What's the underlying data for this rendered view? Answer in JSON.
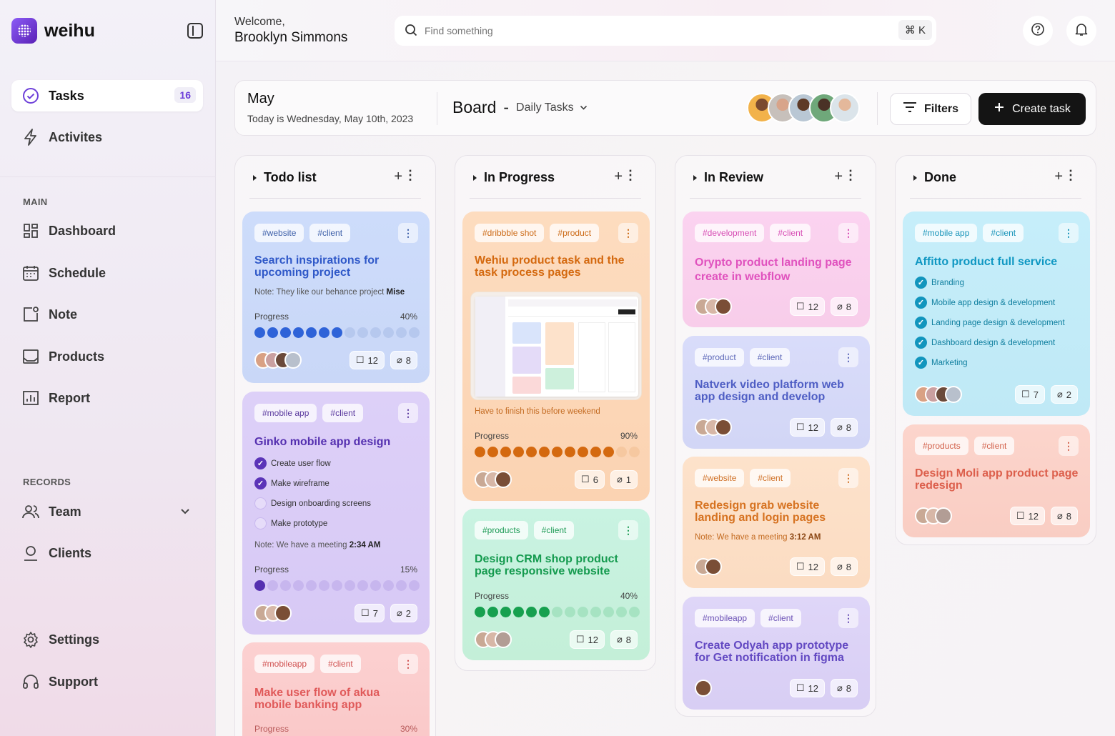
{
  "app": {
    "name": "weihu"
  },
  "sidebar": {
    "nav": [
      {
        "label": "Tasks",
        "badge": "16",
        "icon": "check-circle-icon"
      },
      {
        "label": "Activites",
        "icon": "lightning-icon"
      }
    ],
    "main_label": "MAIN",
    "main": [
      {
        "label": "Dashboard",
        "icon": "grid-icon"
      },
      {
        "label": "Schedule",
        "icon": "calendar-icon"
      },
      {
        "label": "Note",
        "icon": "note-icon"
      },
      {
        "label": "Products",
        "icon": "inbox-icon"
      },
      {
        "label": "Report",
        "icon": "chart-icon"
      }
    ],
    "records_label": "RECORDS",
    "records": [
      {
        "label": "Team",
        "icon": "users-icon"
      },
      {
        "label": "Clients",
        "icon": "user-icon"
      }
    ],
    "bottom": [
      {
        "label": "Settings",
        "icon": "gear-icon"
      },
      {
        "label": "Support",
        "icon": "headset-icon"
      }
    ]
  },
  "topbar": {
    "welcome": "Welcome,",
    "user": "Brooklyn Simmons",
    "search_placeholder": "Find something",
    "shortcut": "⌘ K"
  },
  "header": {
    "month": "May",
    "today": "Today is Wednesday, May 10th, 2023",
    "board": "Board",
    "dash": "-",
    "view": "Daily Tasks",
    "filters": "Filters",
    "create": "Create task"
  },
  "colors": {
    "accent": "#141414",
    "brand": "#6d3fd9"
  },
  "columns": [
    {
      "title": "Todo list",
      "cards": [
        {
          "tags": [
            "#website",
            "#client"
          ],
          "title": "Search inspirations for upcoming project",
          "note_prefix": "Note:  They like our behance project",
          "note_bold": "Mise",
          "progress_label": "Progress",
          "progress": "40%",
          "comments": "12",
          "attachments": "8"
        },
        {
          "tags": [
            "#mobile app",
            "#client"
          ],
          "title": "Ginko mobile app design",
          "checklist": [
            {
              "text": "Create user flow",
              "done": true
            },
            {
              "text": "Make wireframe",
              "done": true
            },
            {
              "text": "Design onboarding screens",
              "done": false
            },
            {
              "text": "Make prototype",
              "done": false
            }
          ],
          "note_prefix": "Note:  We have a meeting",
          "note_bold": "2:34 AM",
          "progress_label": "Progress",
          "progress": "15%",
          "comments": "7",
          "attachments": "2"
        },
        {
          "tags": [
            "#mobileapp",
            "#client"
          ],
          "title": "Make user flow of akua mobile banking app",
          "progress_label": "Progress",
          "progress": "30%"
        }
      ]
    },
    {
      "title": "In Progress",
      "cards": [
        {
          "tags": [
            "#dribbble shot",
            "#product"
          ],
          "title": "Wehiu product task and the task process pages",
          "note": "Have to finish this before weekend",
          "progress_label": "Progress",
          "progress": "90%",
          "comments": "6",
          "attachments": "1"
        },
        {
          "tags": [
            "#products",
            "#client"
          ],
          "title": "Design CRM shop product page responsive website",
          "progress_label": "Progress",
          "progress": "40%",
          "comments": "12",
          "attachments": "8"
        }
      ]
    },
    {
      "title": "In Review",
      "cards": [
        {
          "tags": [
            "#development",
            "#client"
          ],
          "title": "Orypto product landing  page create in webflow",
          "comments": "12",
          "attachments": "8"
        },
        {
          "tags": [
            "#product",
            "#client"
          ],
          "title": "Natverk video platform web app design and develop",
          "comments": "12",
          "attachments": "8"
        },
        {
          "tags": [
            "#website",
            "#client"
          ],
          "title": "Redesign grab website landing and login pages",
          "note_prefix": "Note:  We have a meeting",
          "note_bold": "3:12 AM",
          "comments": "12",
          "attachments": "8"
        },
        {
          "tags": [
            "#mobileapp",
            "#client"
          ],
          "title": "Create Odyah app prototype for Get notification in figma",
          "comments": "12",
          "attachments": "8"
        }
      ]
    },
    {
      "title": "Done",
      "cards": [
        {
          "tags": [
            "#mobile app",
            "#client"
          ],
          "title": "Affitto product full service",
          "checklist": [
            {
              "text": "Branding",
              "done": true
            },
            {
              "text": "Mobile app design & development",
              "done": true
            },
            {
              "text": "Landing page design & development",
              "done": true
            },
            {
              "text": "Dashboard design & development",
              "done": true
            },
            {
              "text": "Marketing",
              "done": true
            }
          ],
          "comments": "7",
          "attachments": "2"
        },
        {
          "tags": [
            "#products",
            "#client"
          ],
          "title": "Design Moli app product page redesign",
          "comments": "12",
          "attachments": "8"
        }
      ]
    }
  ]
}
